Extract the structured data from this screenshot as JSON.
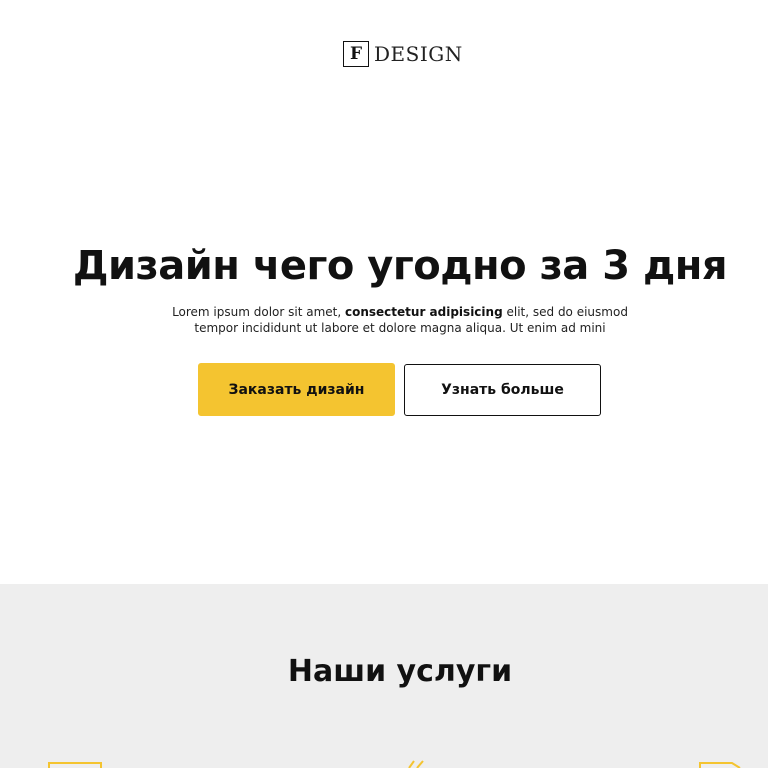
{
  "header": {
    "logo_letter": "F",
    "logo_text": "DESIGN"
  },
  "hero": {
    "title": "Дизайн чего угодно за 3 дня",
    "subtitle_before": "Lorem ipsum dolor sit amet, ",
    "subtitle_bold": "consectetur adipisicing",
    "subtitle_after": " elit, sed do eiusmod tempor incididunt ut labore et dolore magna aliqua. Ut enim ad mini",
    "primary_button": "Заказать дизайн",
    "secondary_button": "Узнать больше"
  },
  "services": {
    "title": "Наши услуги",
    "icons": [
      "monitor-icon",
      "pencil-icon",
      "document-icon"
    ]
  },
  "colors": {
    "accent": "#f4c430",
    "section_bg": "#eeeeee",
    "text": "#111111"
  }
}
